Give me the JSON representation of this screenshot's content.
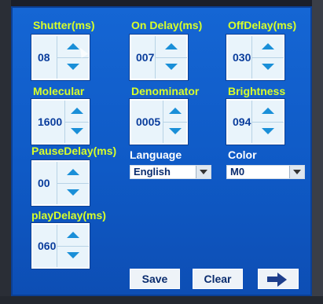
{
  "fields": {
    "shutter": {
      "label": "Shutter(ms)",
      "value": "08"
    },
    "on_delay": {
      "label": "On Delay(ms)",
      "value": "007"
    },
    "off_delay": {
      "label": "OffDelay(ms)",
      "value": "030"
    },
    "molecular": {
      "label": "Molecular",
      "value": "1600"
    },
    "denominator": {
      "label": "Denominator",
      "value": "0005"
    },
    "brightness": {
      "label": "Brightness",
      "value": "094"
    },
    "pause_delay": {
      "label": "PauseDelay(ms)",
      "value": "00"
    },
    "play_delay": {
      "label": "playDelay(ms)",
      "value": "060"
    }
  },
  "language": {
    "label": "Language",
    "selected": "English"
  },
  "color": {
    "label": "Color",
    "selected": "M0"
  },
  "buttons": {
    "save": "Save",
    "clear": "Clear"
  },
  "icons": {
    "up": "arrow-up-icon",
    "down": "arrow-down-icon",
    "next": "arrow-right-icon"
  },
  "colors": {
    "background": "#1566d4",
    "label": "#d8ff2a",
    "value_text": "#0a3d9c",
    "arrow": "#1a8fd8"
  }
}
